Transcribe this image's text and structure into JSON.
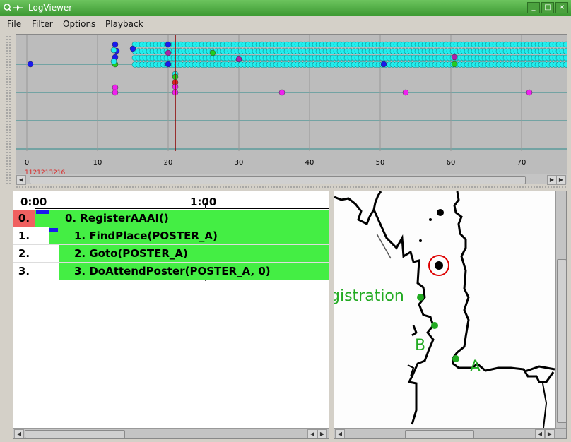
{
  "window": {
    "title": "LogViewer"
  },
  "menu": [
    {
      "label": "File"
    },
    {
      "label": "Filter"
    },
    {
      "label": "Options"
    },
    {
      "label": "Playback"
    }
  ],
  "timeline": {
    "axis_ticks": [
      "0",
      "10",
      "20",
      "30",
      "40",
      "50",
      "60",
      "70"
    ],
    "timestamp": "1121213216",
    "cursor_value": 21
  },
  "task_panel": {
    "time_start": "0:00",
    "time_mid": "1:00",
    "tasks": [
      {
        "index": "0.",
        "label": "0. RegisterAAAI()"
      },
      {
        "index": "1.",
        "label": "1. FindPlace(POSTER_A)"
      },
      {
        "index": "2.",
        "label": "2. Goto(POSTER_A)"
      },
      {
        "index": "3.",
        "label": "3. DoAttendPoster(POSTER_A, 0)"
      }
    ]
  },
  "map": {
    "labels": {
      "registration": "gistration",
      "b": "B",
      "a": "A"
    }
  },
  "colors": {
    "task_bar": "#44ee44",
    "active_task": "#f06060",
    "progress": "#1a1aee",
    "cursor": "#8b0000",
    "map_label": "#22aa22"
  }
}
